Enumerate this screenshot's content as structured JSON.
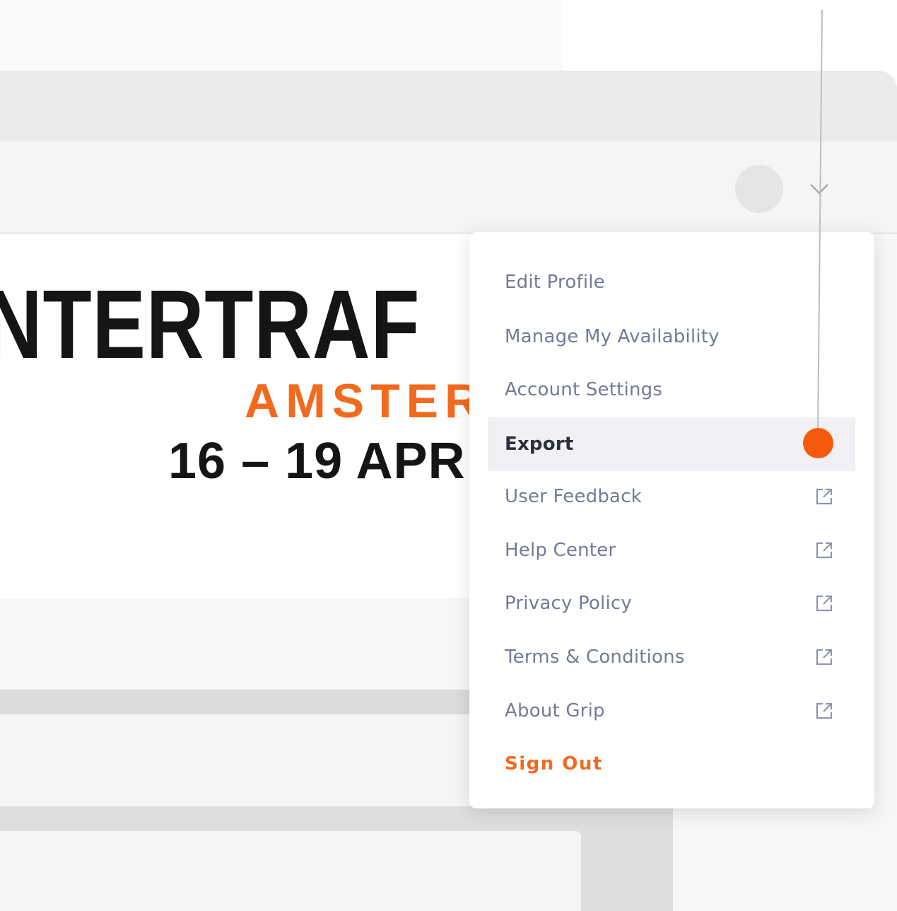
{
  "banner": {
    "title": "NTERTRAF",
    "city": "AMSTER",
    "dates": "16 – 19 APR"
  },
  "menu": {
    "items": [
      {
        "label": "Edit Profile",
        "external": false,
        "active": false
      },
      {
        "label": "Manage My Availability",
        "external": false,
        "active": false
      },
      {
        "label": "Account Settings",
        "external": false,
        "active": false
      },
      {
        "label": "Export",
        "external": false,
        "active": true
      },
      {
        "label": "User Feedback",
        "external": true,
        "active": false
      },
      {
        "label": "Help Center",
        "external": true,
        "active": false
      },
      {
        "label": "Privacy Policy",
        "external": true,
        "active": false
      },
      {
        "label": "Terms & Conditions",
        "external": true,
        "active": false
      },
      {
        "label": "About Grip",
        "external": true,
        "active": false
      }
    ],
    "sign_out": "Sign Out"
  },
  "icons": {
    "external": "external-link-icon",
    "dropdown": "chevron-down-icon"
  },
  "colors": {
    "accent": "#f26a1e",
    "menu_text": "#737a99",
    "active_bg": "#f0f0f5",
    "pointer": "#f55a0d"
  }
}
